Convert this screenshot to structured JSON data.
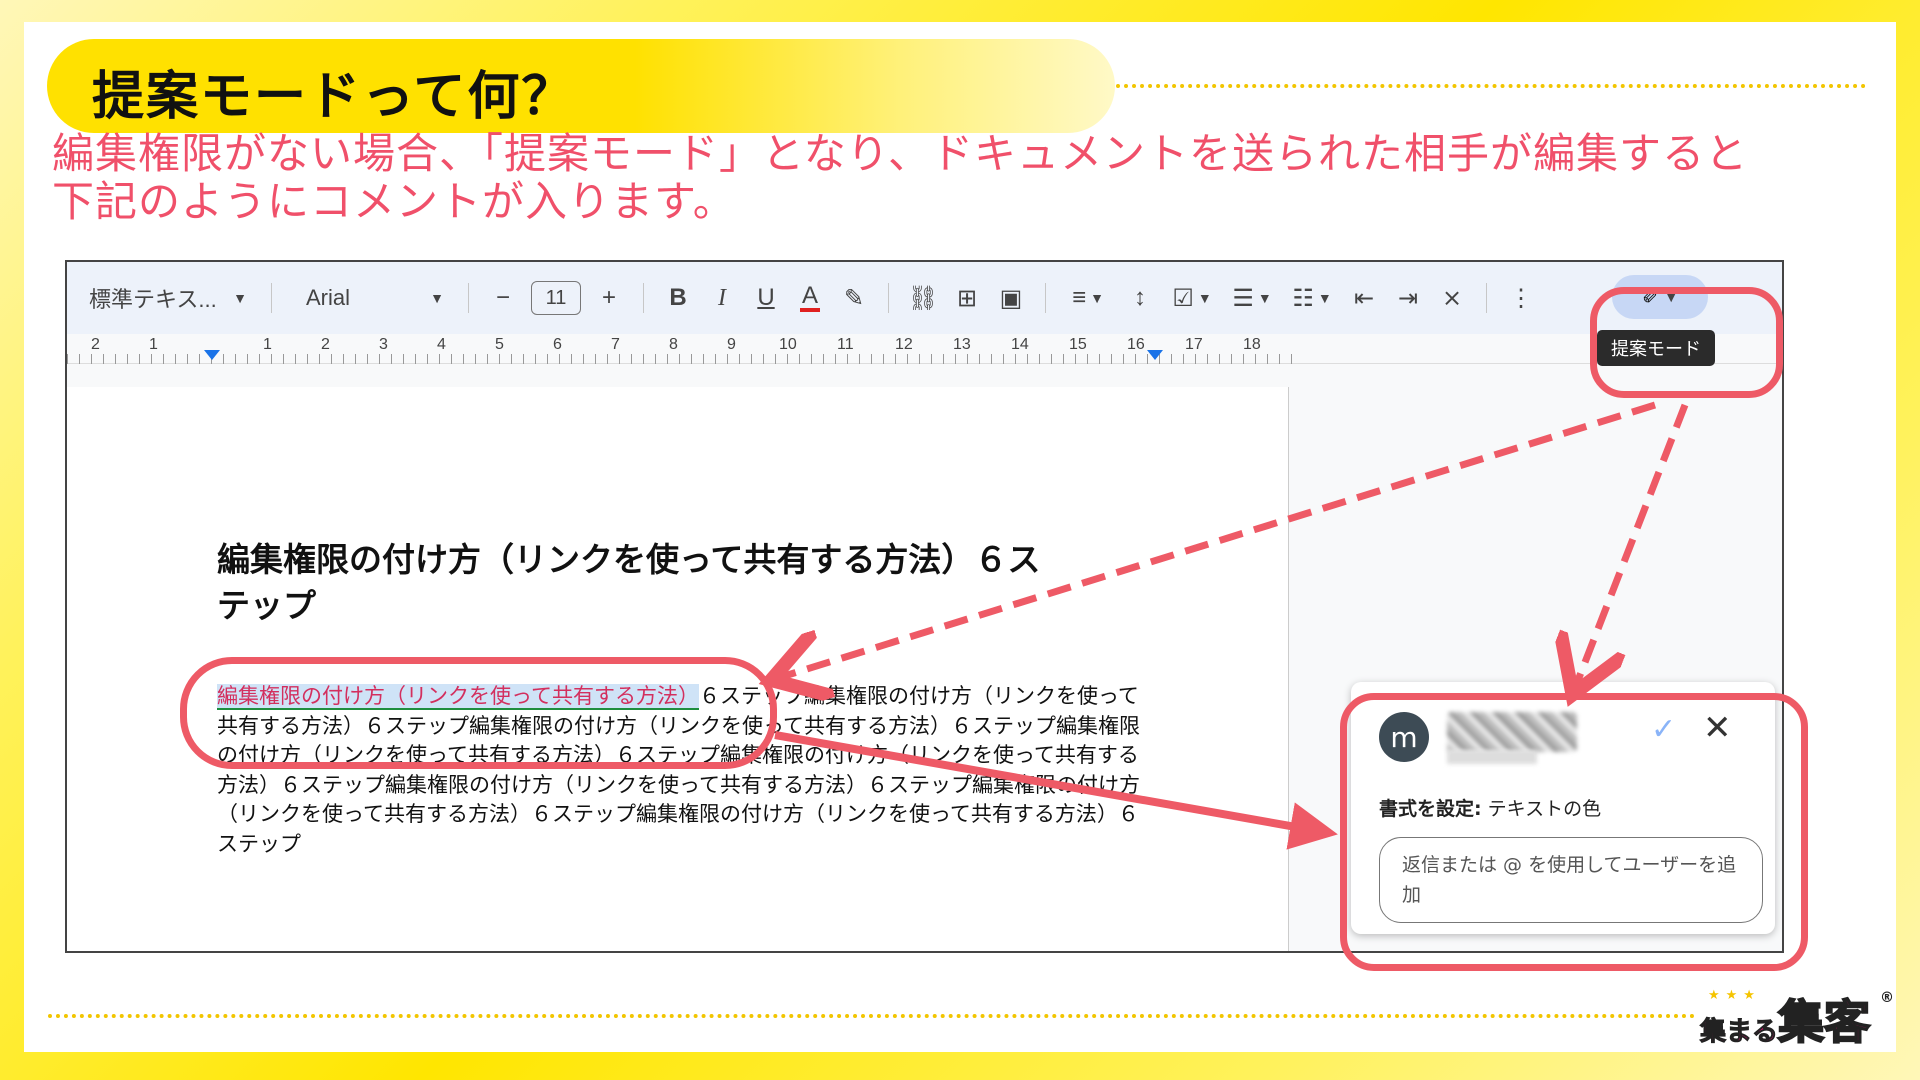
{
  "slide": {
    "title": "提案モードって何？",
    "intro_lines": [
      "編集権限がない場合、「提案モード」となり、ドキュメントを送られた相手が編集すると",
      "下記のようにコメントが入ります。"
    ]
  },
  "toolbar": {
    "style_label": "標準テキス...",
    "font_label": "Arial",
    "font_size": "11",
    "minus": "−",
    "plus": "+",
    "bold": "B",
    "italic": "I",
    "underline": "U",
    "text_color": "A",
    "suggest_tooltip": "提案モード",
    "icons": [
      "dropdown-icon",
      "minus-icon",
      "plus-icon",
      "bold-icon",
      "italic-icon",
      "underline-icon",
      "text-color-icon",
      "highlight-icon",
      "link-icon",
      "add-comment-icon",
      "image-icon",
      "align-icon",
      "line-spacing-icon",
      "checklist-icon",
      "bullet-list-icon",
      "numbered-list-icon",
      "decrease-indent-icon",
      "increase-indent-icon",
      "clear-format-icon",
      "more-icon",
      "suggest-edit-icon"
    ]
  },
  "ruler": {
    "labels": [
      "2",
      "1",
      "1",
      "2",
      "3",
      "4",
      "5",
      "6",
      "7",
      "8",
      "9",
      "10",
      "11",
      "12",
      "13",
      "14",
      "15",
      "16",
      "17",
      "18"
    ]
  },
  "document": {
    "heading_line1": "編集権限の付け方（リンクを使って共有する方法）６ス",
    "heading_line2": "テップ",
    "suggested_text": "編集権限の付け方（リンクを使って共有する方法）",
    "body_rest": "６ステップ編集権限の付け方（リンクを使って共有する方法）６ステップ編集権限の付け方（リンクを使って共有する方法）６ステップ編集権限の付け方（リンクを使って共有する方法）６ステップ編集権限の付け方（リンクを使って共有する方法）６ステップ編集権限の付け方（リンクを使って共有する方法）６ステップ編集権限の付け方（リンクを使って共有する方法）６ステップ編集権限の付け方（リンクを使って共有する方法）６ステップ"
  },
  "comment": {
    "avatar_letter": "m",
    "format_label": "書式を設定:",
    "format_value": "テキストの色",
    "reply_placeholder": "返信または @ を使用してユーザーを追加"
  },
  "logo": {
    "small_text": "集まる",
    "big_text": "集客",
    "registered": "®"
  },
  "colors": {
    "accent_yellow": "#ffe100",
    "callout_red": "#ee5a66",
    "intro_pink": "#f0506a",
    "suggest_text": "#d32f5e",
    "suggest_bg": "#cfe3f7"
  }
}
